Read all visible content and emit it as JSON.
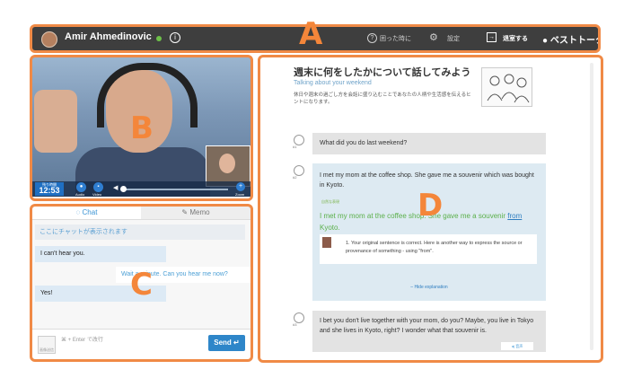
{
  "annotations": [
    "A",
    "B",
    "C",
    "D"
  ],
  "topbar": {
    "username": "Amir Ahmedinovic",
    "info_icon": "info-icon",
    "help_label": "困った時に",
    "settings_label": "設定",
    "exit_label": "退室する",
    "logo_text": "ベストトーク"
  },
  "video": {
    "timer_label": "残り時間",
    "timer_value": "12:53",
    "audio_label": "Audio",
    "video_label": "Video",
    "zoom_label": "Zoom"
  },
  "chat": {
    "tab_chat": "Chat",
    "tab_memo": "Memo",
    "hint": "ここにチャットが表示されます",
    "messages": [
      "I can't hear you.",
      "Wait a minute. Can you hear me now?",
      "Yes!"
    ],
    "attach_label": "画像送信",
    "input_placeholder": "⌘ + Enter で改行",
    "send_label": "Send ↵"
  },
  "lesson": {
    "title": "週末に何をしたかについて話してみよう",
    "subtitle": "Talking about your weekend",
    "description": "休日や週末の過ごし方を会話に盛り込むことであなたの人柄や生活感を伝えるヒントになります。",
    "speaker1": "#1",
    "speaker2": "#2",
    "speaker3": "#3",
    "q1": "What did you do last weekend?",
    "a1": "I met my mom at the coffee shop. She gave me a souvenir which was bought in Kyoto.",
    "corr_label": "自然な表現",
    "corrected_prefix": "I met my mom at the coffee shop. She gave me a souvenir ",
    "corrected_from": "from",
    "corrected_suffix": " Kyoto.",
    "explanation": "1. Your original sentence is correct. Here is another way to express the source or provenance of something - using \"from\".",
    "hide_explanation": "– Hide explanation",
    "q2": "I bet you don't live together with your mom, do you? Maybe, you live in Tokyo and she lives in Kyoto, right? I wonder what that souvenir is.",
    "q2_button": "◂) 音声"
  }
}
